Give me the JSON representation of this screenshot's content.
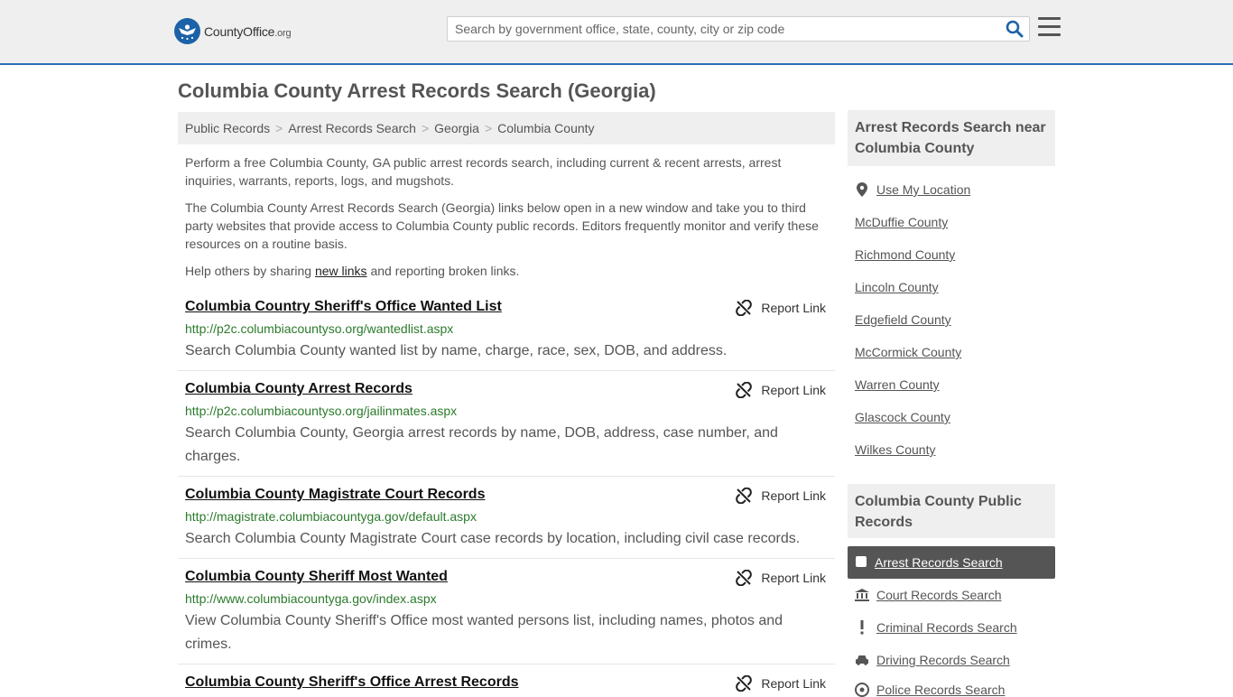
{
  "header": {
    "logo_text": "CountyOffice",
    "logo_suffix": ".org",
    "search_placeholder": "Search by government office, state, county, city or zip code"
  },
  "page_title": "Columbia County Arrest Records Search (Georgia)",
  "breadcrumb": [
    "Public Records",
    "Arrest Records Search",
    "Georgia",
    "Columbia County"
  ],
  "intro": {
    "p1": "Perform a free Columbia County, GA public arrest records search, including current & recent arrests, arrest inquiries, warrants, reports, logs, and mugshots.",
    "p2": "The Columbia County Arrest Records Search (Georgia) links below open in a new window and take you to third party websites that provide access to Columbia County public records. Editors frequently monitor and verify these resources on a routine basis.",
    "p3_before": "Help others by sharing ",
    "p3_link": "new links",
    "p3_after": " and reporting broken links."
  },
  "report_label": "Report Link",
  "results": [
    {
      "title": "Columbia Country Sheriff's Office Wanted List",
      "url": "http://p2c.columbiacountyso.org/wantedlist.aspx",
      "desc": "Search Columbia County wanted list by name, charge, race, sex, DOB, and address."
    },
    {
      "title": "Columbia County Arrest Records",
      "url": "http://p2c.columbiacountyso.org/jailinmates.aspx",
      "desc": "Search Columbia County, Georgia arrest records by name, DOB, address, case number, and charges."
    },
    {
      "title": "Columbia County Magistrate Court Records",
      "url": "http://magistrate.columbiacountyga.gov/default.aspx",
      "desc": "Search Columbia County Magistrate Court case records by location, including civil case records."
    },
    {
      "title": "Columbia County Sheriff Most Wanted",
      "url": "http://www.columbiacountyga.gov/index.aspx",
      "desc": "View Columbia County Sheriff's Office most wanted persons list, including names, photos and crimes."
    },
    {
      "title": "Columbia County Sheriff's Office Arrest Records",
      "url": "",
      "desc": ""
    }
  ],
  "sidebar": {
    "near_heading": "Arrest Records Search near Columbia County",
    "use_location": "Use My Location",
    "nearby": [
      "McDuffie County",
      "Richmond County",
      "Lincoln County",
      "Edgefield County",
      "McCormick County",
      "Warren County",
      "Glascock County",
      "Wilkes County"
    ],
    "public_heading": "Columbia County Public Records",
    "records": [
      {
        "label": "Arrest Records Search",
        "icon": "square-icon"
      },
      {
        "label": "Court Records Search",
        "icon": "courthouse-icon"
      },
      {
        "label": "Criminal Records Search",
        "icon": "exclamation-icon"
      },
      {
        "label": "Driving Records Search",
        "icon": "car-icon"
      },
      {
        "label": "Police Records Search",
        "icon": "badge-icon"
      }
    ]
  }
}
